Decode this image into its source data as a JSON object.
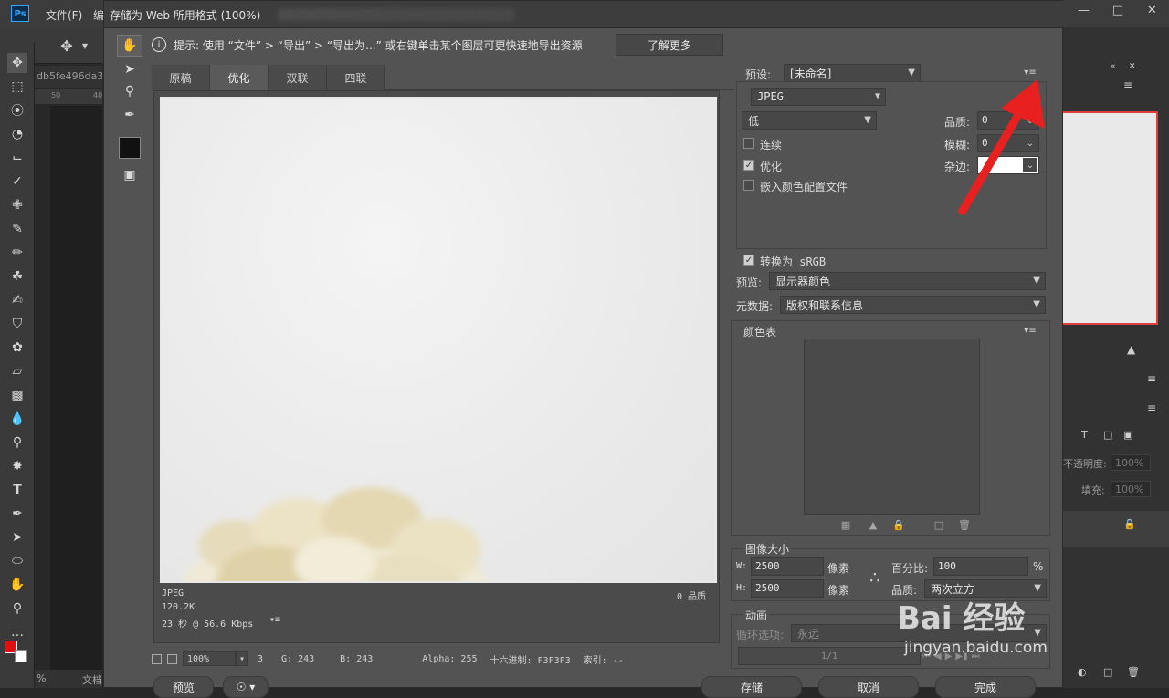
{
  "ps": {
    "logo": "Ps",
    "menu_file": "文件(F)",
    "menu_edit": "编",
    "doc_tab": "db5fe496da3",
    "ruler_a": "50",
    "ruler_b": "40",
    "status_zoom": "%",
    "status_doc": "文档",
    "opacity_label": "不透明度:",
    "opacity_value": "100%",
    "fill_label": "填充:",
    "fill_value": "100%"
  },
  "dialog": {
    "title": "存储为 Web 所用格式 (100%)",
    "tip_text": "提示: 使用 “文件” > “导出” > “导出为...” 或右键单击某个图层可更快速地导出资源",
    "learn_more": "了解更多",
    "tabs": [
      "原稿",
      "优化",
      "双联",
      "四联"
    ],
    "active_tab": "优化",
    "preview": {
      "format": "JPEG",
      "size": "120.2K",
      "time": "23 秒 @ 56.6 Kbps",
      "quality": "0 品质"
    },
    "status": {
      "zoom": "100%",
      "r": "3",
      "g": "G: 243",
      "b": "B: 243",
      "alpha": "Alpha: 255",
      "hex": "十六进制: F3F3F3",
      "index": "索引: --"
    },
    "buttons": {
      "preview": "预览",
      "save": "存储",
      "cancel": "取消",
      "done": "完成"
    }
  },
  "settings": {
    "preset_label": "预设:",
    "preset_value": "[未命名]",
    "format_value": "JPEG",
    "quality_level": "低",
    "quality_label": "品质:",
    "quality_value": "0",
    "blur_label": "模糊:",
    "blur_value": "0",
    "matte_label": "杂边:",
    "progressive_label": "连续",
    "optimized_label": "优化",
    "embed_profile_label": "嵌入颜色配置文件",
    "convert_srgb_label": "转换为 sRGB",
    "preview_label": "预览:",
    "preview_value": "显示器颜色",
    "metadata_label": "元数据:",
    "metadata_value": "版权和联系信息",
    "color_table_label": "颜色表",
    "image_size_label": "图像大小",
    "width_label": "W:",
    "width_value": "2500",
    "height_label": "H:",
    "height_value": "2500",
    "px_label": "像素",
    "percent_label": "百分比:",
    "percent_value": "100",
    "percent_sign": "%",
    "resample_label": "品质:",
    "resample_value": "两次立方",
    "animation_label": "动画",
    "loop_label": "循环选项:",
    "loop_value": "永远",
    "frame_counter": "1/1"
  },
  "watermark": {
    "brand": "Bai 经验",
    "site": "jingyan.baidu.com"
  },
  "colors": {
    "arrow": "#e8201f",
    "accent": "#31a8ff"
  }
}
